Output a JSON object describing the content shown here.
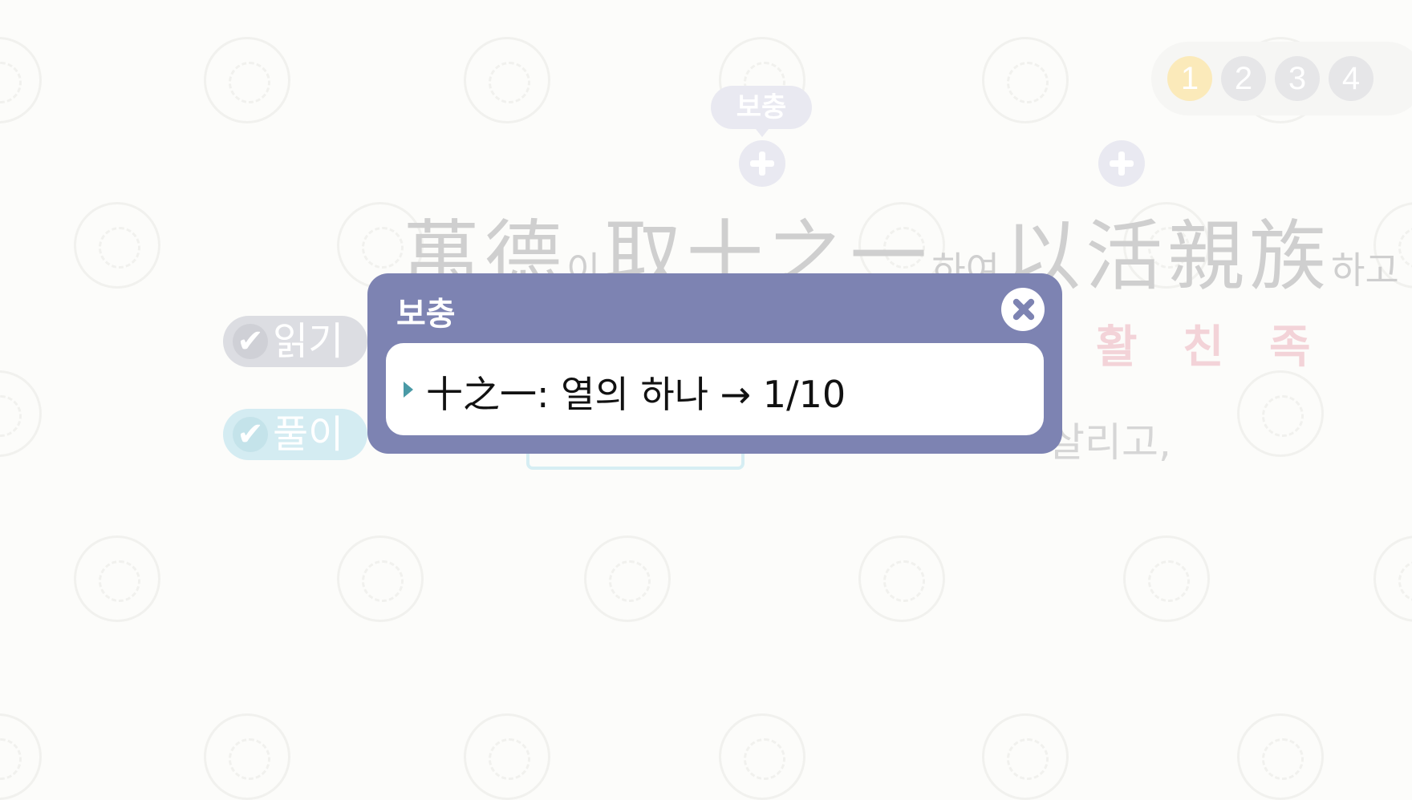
{
  "page_tabs": [
    "1",
    "2",
    "3",
    "4"
  ],
  "active_page": "1",
  "supplement_tag": "보충",
  "main_text": {
    "seg1": "萬德",
    "seg2": "이",
    "seg3": "取十之一",
    "seg4": "하여",
    "seg5": "以活親族",
    "seg6": "하고"
  },
  "buttons": {
    "read": "읽기",
    "explain": "풀이",
    "check_glyph": "✔"
  },
  "pronunciation": [
    "활",
    "친",
    "족"
  ],
  "explain_tail": "살리고,",
  "popup": {
    "title": "보충",
    "text": "十之一: 열의 하나 → 1/10"
  },
  "colors": {
    "popup_bg": "#7d83b2",
    "active_tab": "#fbeaba",
    "read_btn": "#dcdde2",
    "explain_btn": "#d4ecf2"
  }
}
